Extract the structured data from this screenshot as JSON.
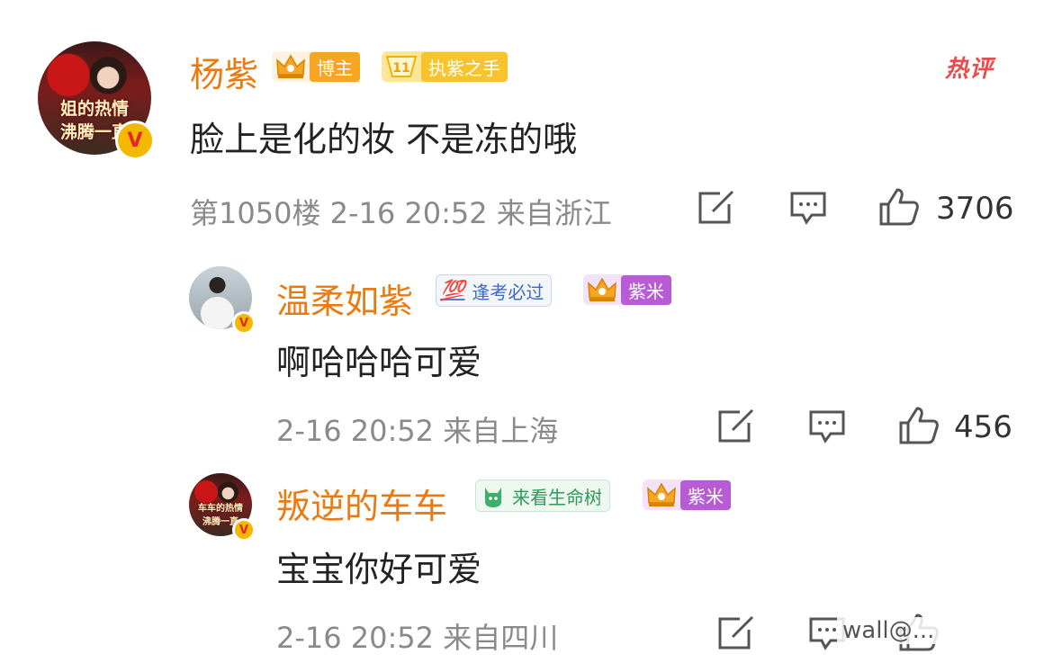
{
  "hot_label": "热评",
  "comments": [
    {
      "username": "杨紫",
      "avatar_caption_1": "姐的热情",
      "avatar_caption_2": "沸腾一直",
      "badges": [
        {
          "label": "博主",
          "icon": "crown-icon",
          "color": "#f6a623"
        },
        {
          "label": "执紫之手",
          "icon": "level-11-diamond-icon",
          "level": "11",
          "color": "#f8c32c"
        }
      ],
      "text": "脸上是化的妆 不是冻的哦",
      "meta": "第1050楼 2-16 20:52 来自浙江",
      "likes": "3706"
    },
    {
      "username": "温柔如紫",
      "badges": [
        {
          "label": "逢考必过",
          "icon": "100-points-icon",
          "color": "#4a7fd8"
        },
        {
          "label": "紫米",
          "icon": "crown-icon",
          "color": "#b85cd6"
        }
      ],
      "text": "啊哈哈哈可爱",
      "meta": "2-16 20:52 来自上海",
      "likes": "456"
    },
    {
      "username": "叛逆的车车",
      "avatar_caption_1": "车车的热情",
      "avatar_caption_2": "沸腾一直",
      "badges": [
        {
          "label": "来看生命树",
          "icon": "green-cat-icon",
          "color": "#3ab06b"
        },
        {
          "label": "紫米",
          "icon": "crown-icon",
          "color": "#b85cd6"
        }
      ],
      "text": "宝宝你好可爱",
      "meta": "2-16 20:52 来自四川"
    }
  ],
  "watermark": "wall@..."
}
